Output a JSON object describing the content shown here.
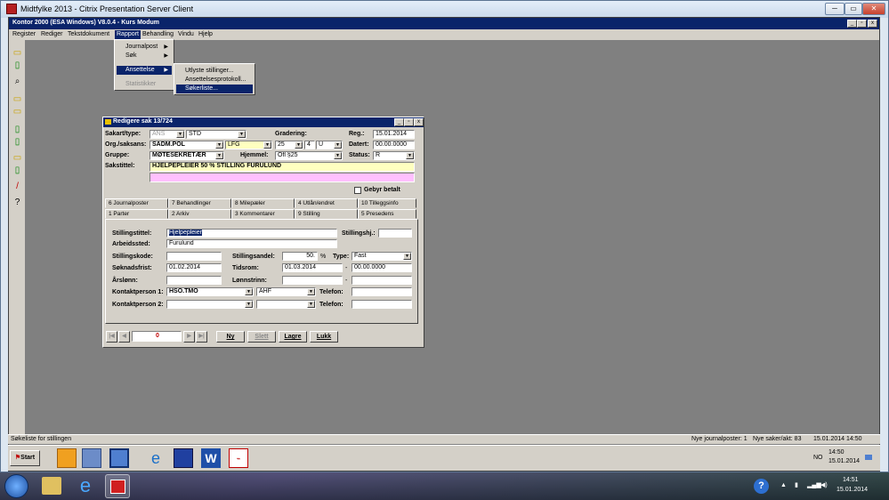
{
  "citrix": {
    "title": "Midtfylke 2013 - Citrix Presentation Server Client",
    "min": "─",
    "max": "▭",
    "close": "✕"
  },
  "app": {
    "title": "Kontor 2000 (ESA Windows) V8.0.4 - Kurs Modum",
    "mdi_min": "_",
    "mdi_max": "▫",
    "mdi_close": "x"
  },
  "menu": [
    "Register",
    "Rediger",
    "Tekstdokument",
    "Rapport",
    "Behandling",
    "Vindu",
    "Hjelp"
  ],
  "rapport_menu": {
    "items": [
      "Journalpost",
      "Søk",
      "Ansettelse",
      "Statistikker"
    ]
  },
  "ansettelse_menu": {
    "items": [
      "Utlyste stillinger...",
      "Ansettelsesprotokoll...",
      "Søkerliste..."
    ]
  },
  "dialog": {
    "title": "Redigere sak 13/724",
    "labels": {
      "saktype": "Sakart/type:",
      "gradering": "Gradering:",
      "reg": "Reg.:",
      "org": "Org./saksans:",
      "datert": "Datert:",
      "gruppe": "Gruppe:",
      "hjemmel": "Hjemmel:",
      "status": "Status:",
      "sakstittel": "Sakstittel:",
      "gebyr": "Gebyr betalt"
    },
    "values": {
      "sakart": "ANS",
      "type": "STD",
      "reg": "15.01.2014",
      "org": "SADM.POL",
      "saksans": "LFG",
      "grad1": "25",
      "grad2": "4",
      "grad3": "U",
      "datert": "00.00.0000",
      "gruppe": "MØTESEKRETÆR",
      "hjemmel": "Ofl §25",
      "status": "R",
      "sakstittel": "HJELPEPLEIER 50 % STILLING FURULUND"
    },
    "tabs_row1": [
      "6 Journalposter",
      "7 Behandlinger",
      "8 Milepæler",
      "4 Utlån/endret",
      "10 Tilleggsinfo"
    ],
    "tabs_row2": [
      "1 Parter",
      "2 Arkiv",
      "3 Kommentarer",
      "9 Stilling",
      "5 Presedens"
    ],
    "stilling": {
      "labels": {
        "stillingstittel": "Stillingstittel:",
        "stillingshj": "Stillingshj.:",
        "arbeidssted": "Arbeidssted:",
        "stillingskode": "Stillingskode:",
        "stillingsandel": "Stillingsandel:",
        "pct": "%",
        "type": "Type:",
        "soknadsfrist": "Søknadsfrist:",
        "tidsrom": "Tidsrom:",
        "dash": "-",
        "arslonn": "Årslønn:",
        "lonnstrinn": "Lønnstrinn:",
        "kontakt1": "Kontaktperson 1:",
        "kontakt2": "Kontaktperson 2:",
        "telefon": "Telefon:"
      },
      "values": {
        "stillingstittel": "Hjelpepleier",
        "arbeidssted": "Furulund",
        "stillingsandel": "50.",
        "type": "Fast",
        "soknadsfrist": "01.02.2014",
        "tidsrom_fra": "01.03.2014",
        "tidsrom_til": "00.00.0000",
        "kontakt1": "HSO.TMO",
        "kontakt1b": "AHF"
      }
    },
    "nav": {
      "counter": "0",
      "first": "|◀",
      "prev": "◀",
      "next": "▶",
      "last": "▶|"
    },
    "buttons": {
      "ny": "Ny",
      "slett": "Slett",
      "lagre": "Lagre",
      "lukk": "Lukk"
    }
  },
  "statusbar": {
    "left": "Søkeliste for stillingen",
    "nye_jp": "Nye journalposter: 1",
    "nye_saker": "Nye saker/akt: 83",
    "datetime": "15.01.2014 14:50"
  },
  "citrix_taskbar": {
    "start": "Start",
    "lang": "NO",
    "time": "14:50",
    "date": "15.01.2014"
  },
  "win_taskbar": {
    "time": "14:51",
    "date": "15.01.2014"
  }
}
